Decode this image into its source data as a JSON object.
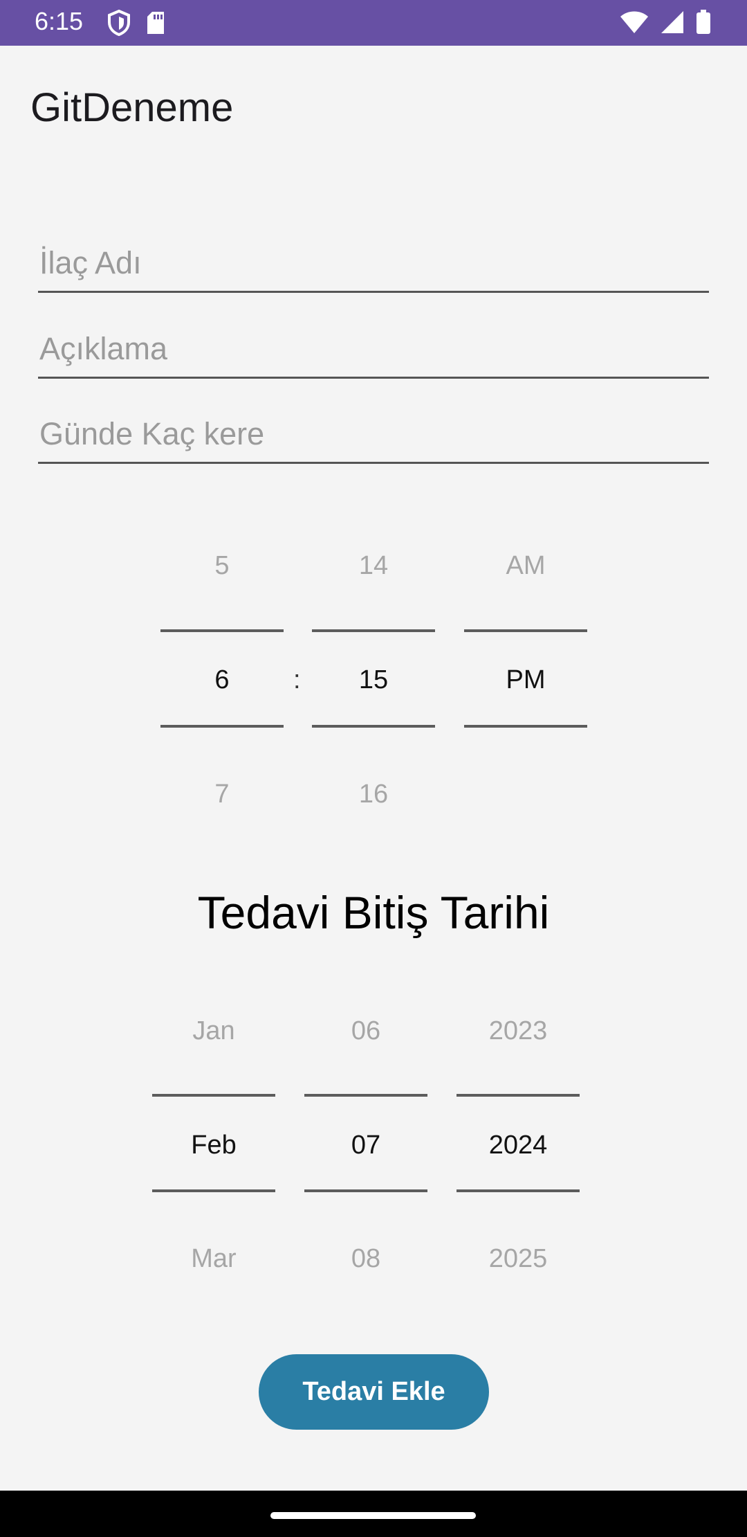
{
  "status_bar": {
    "time": "6:15",
    "icons_left": [
      "shield-icon",
      "sd-card-icon"
    ],
    "icons_right": [
      "wifi-icon",
      "signal-icon",
      "battery-icon"
    ],
    "color": "#6750a4"
  },
  "app_bar": {
    "title": "GitDeneme"
  },
  "form": {
    "drug_name_placeholder": "İlaç Adı",
    "description_placeholder": "Açıklama",
    "times_per_day_placeholder": "Günde Kaç kere"
  },
  "time_picker": {
    "hour": {
      "prev": "5",
      "selected": "6",
      "next": "7"
    },
    "separator": ":",
    "minute": {
      "prev": "14",
      "selected": "15",
      "next": "16"
    },
    "ampm": {
      "prev": "AM",
      "selected": "PM"
    }
  },
  "end_date": {
    "title": "Tedavi Bitiş Tarihi",
    "month": {
      "prev": "Jan",
      "selected": "Feb",
      "next": "Mar"
    },
    "day": {
      "prev": "06",
      "selected": "07",
      "next": "08"
    },
    "year": {
      "prev": "2023",
      "selected": "2024",
      "next": "2025"
    }
  },
  "actions": {
    "add_label": "Tedavi Ekle",
    "button_color": "#2a7ea5"
  }
}
